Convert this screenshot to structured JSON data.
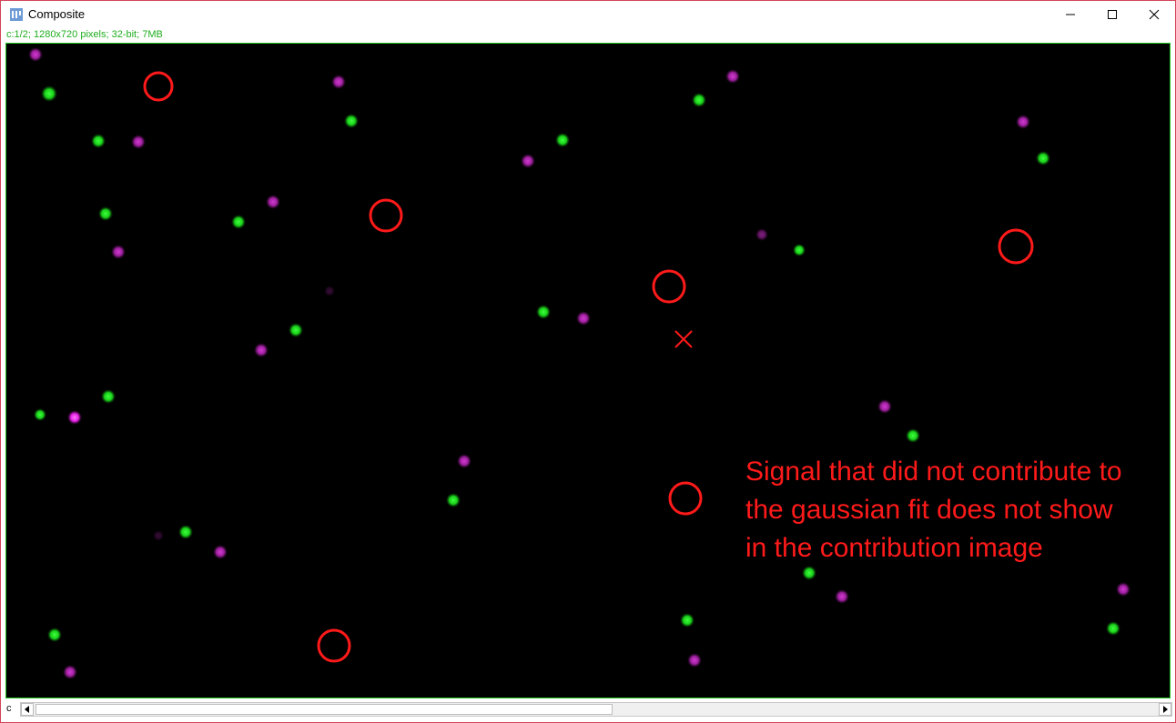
{
  "window": {
    "title": "Composite",
    "status_text": "c:1/2; 1280x720 pixels; 32-bit; 7MB"
  },
  "image": {
    "annotation_lines": [
      "Signal that did not contribute to",
      "the gaussian fit does not show",
      "in the contribution image"
    ]
  },
  "scroll": {
    "channel_label": "c"
  },
  "icons": [
    "imagej-icon",
    "minimize-icon",
    "maximize-icon",
    "close-icon",
    "scroll-left-icon",
    "scroll-right-icon"
  ],
  "colors": {
    "green": "#17d317",
    "magenta": "#b020b0",
    "annotation_red": "#ff1a1a",
    "border": "#d4455a"
  },
  "scroll_position": 0.5
}
